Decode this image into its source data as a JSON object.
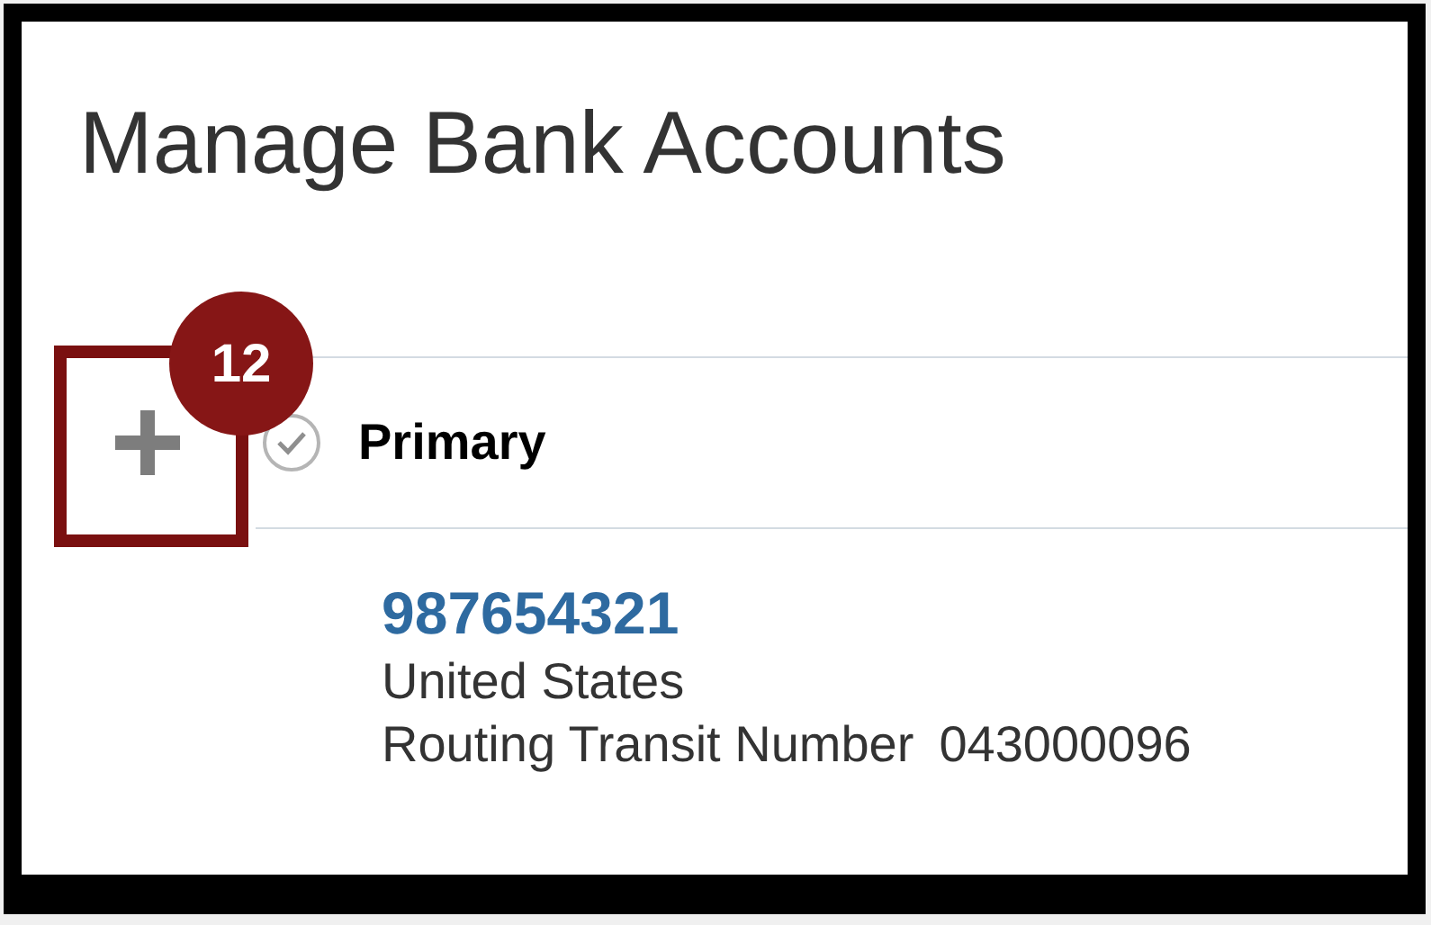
{
  "title": "Manage Bank Accounts",
  "callout": {
    "number": "12"
  },
  "section": {
    "heading": "Primary"
  },
  "account": {
    "number": "987654321",
    "country": "United States",
    "routing_label": "Routing Transit Number",
    "routing_number": "043000096"
  }
}
